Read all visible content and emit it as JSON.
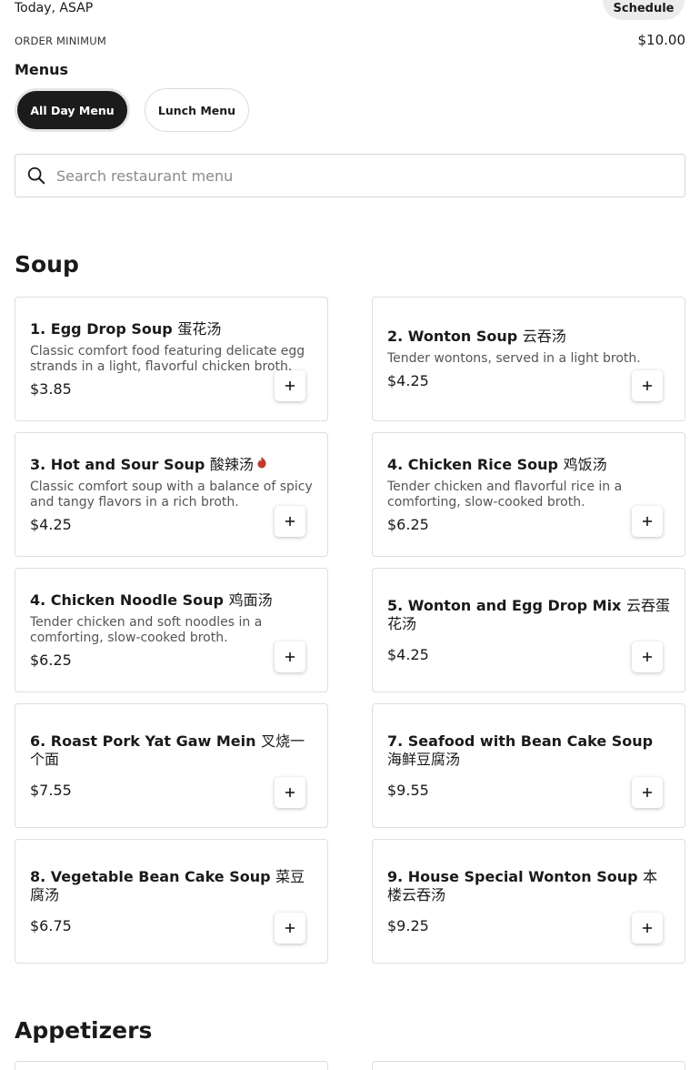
{
  "header": {
    "delivery_time": "Today, ASAP",
    "schedule_label": "Schedule",
    "order_minimum_label": "ORDER MINIMUM",
    "order_minimum_value": "$10.00"
  },
  "menus": {
    "title": "Menus",
    "tabs": [
      {
        "label": "All Day Menu",
        "active": true
      },
      {
        "label": "Lunch Menu",
        "active": false
      }
    ]
  },
  "search": {
    "placeholder": "Search restaurant menu",
    "icon": "search-icon"
  },
  "sections": [
    {
      "title": "Soup",
      "items": [
        {
          "name": "1. Egg Drop Soup",
          "cjk": "蛋花汤",
          "description": "Classic comfort food featuring delicate egg strands in a light, flavorful chicken broth.",
          "price": "$3.85",
          "spicy": false
        },
        {
          "name": "2. Wonton Soup",
          "cjk": "云吞汤",
          "description": "Tender wontons, served in a light broth.",
          "price": "$4.25",
          "spicy": false
        },
        {
          "name": "3. Hot and Sour Soup",
          "cjk": "酸辣汤",
          "description": "Classic comfort soup with a balance of spicy and tangy flavors in a rich broth.",
          "price": "$4.25",
          "spicy": true
        },
        {
          "name": "4. Chicken Rice Soup",
          "cjk": "鸡饭汤",
          "description": "Tender chicken and flavorful rice in a comforting, slow-cooked broth.",
          "price": "$6.25",
          "spicy": false
        },
        {
          "name": "4. Chicken Noodle Soup",
          "cjk": "鸡面汤",
          "description": "Tender chicken and soft noodles in a comforting, slow-cooked broth.",
          "price": "$6.25",
          "spicy": false
        },
        {
          "name": "5. Wonton and Egg Drop Mix",
          "cjk": "云吞蛋花汤",
          "description": "",
          "price": "$4.25",
          "spicy": false
        },
        {
          "name": "6. Roast Pork Yat Gaw Mein",
          "cjk": "叉烧一个面",
          "description": "",
          "price": "$7.55",
          "spicy": false
        },
        {
          "name": "7. Seafood with Bean Cake Soup",
          "cjk": "海鲜豆腐汤",
          "description": "",
          "price": "$9.55",
          "spicy": false
        },
        {
          "name": "8. Vegetable Bean Cake Soup",
          "cjk": "菜豆腐汤",
          "description": "",
          "price": "$6.75",
          "spicy": false
        },
        {
          "name": "9. House Special Wonton Soup",
          "cjk": "本楼云吞汤",
          "description": "",
          "price": "$9.25",
          "spicy": false
        }
      ]
    },
    {
      "title": "Appetizers",
      "items": []
    }
  ],
  "icons": {
    "add": "plus-icon",
    "spicy": "chili-icon"
  },
  "colors": {
    "active_chip": "#1b1b1b",
    "spicy": "#c0392b"
  }
}
